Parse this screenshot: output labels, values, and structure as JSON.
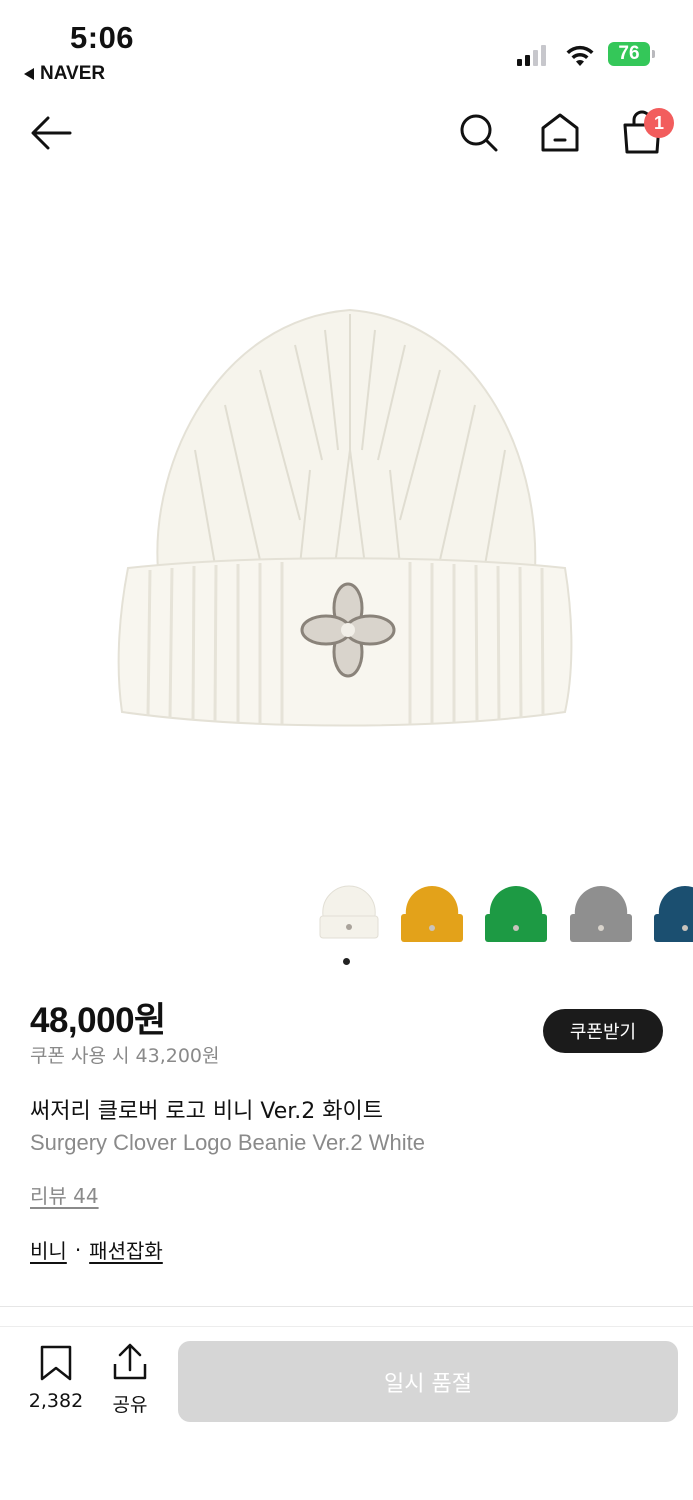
{
  "status_bar": {
    "time": "5:06",
    "back_app": "NAVER",
    "battery": "76"
  },
  "header": {
    "cart_count": "1"
  },
  "product": {
    "price": "48,000원",
    "coupon_price": "쿠폰 사용 시 43,200원",
    "coupon_button": "쿠폰받기",
    "name_ko": "써저리 클로버 로고 비니 Ver.2 화이트",
    "name_en": "Surgery Clover Logo Beanie Ver.2 White",
    "review_link": "리뷰 44",
    "categories": [
      "비니",
      "패션잡화"
    ],
    "category_separator": "·"
  },
  "colors": {
    "swatches": [
      "#f4f2ea",
      "#e3a21a",
      "#1d9a44",
      "#8f8f8f",
      "#1b4f70"
    ],
    "active_index": 0
  },
  "bottom_bar": {
    "bookmark_count": "2,382",
    "share_label": "공유",
    "soldout_label": "일시 품절"
  }
}
